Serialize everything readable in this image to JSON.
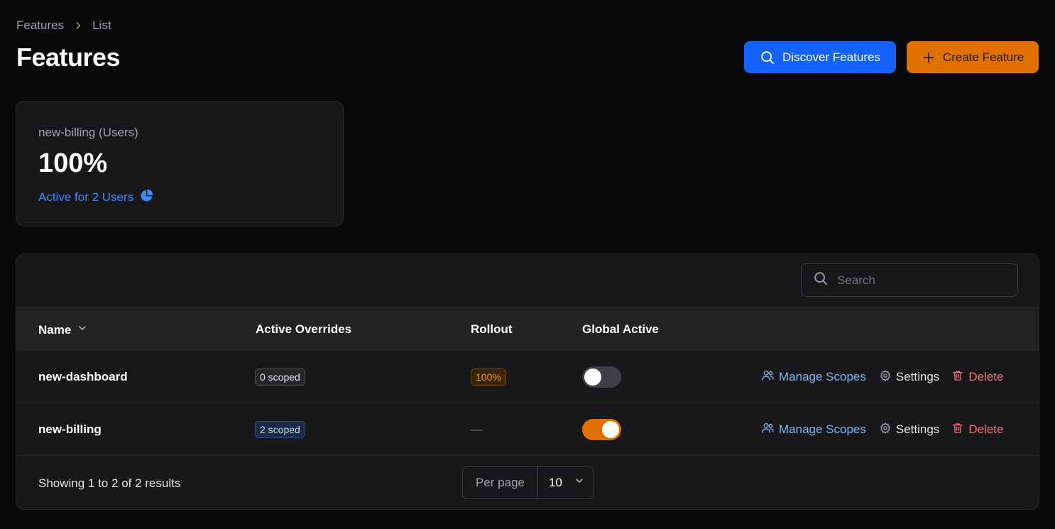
{
  "breadcrumb": {
    "items": [
      "Features",
      "List"
    ]
  },
  "header": {
    "title": "Features",
    "discover_label": "Discover Features",
    "create_label": "Create Feature"
  },
  "stat": {
    "label": "new-billing (Users)",
    "value": "100%",
    "description": "Active for 2 Users"
  },
  "search": {
    "placeholder": "Search",
    "value": ""
  },
  "table": {
    "columns": [
      "Name",
      "Active Overrides",
      "Rollout",
      "Global Active"
    ],
    "rows": [
      {
        "name": "new-dashboard",
        "overrides": "0 scoped",
        "rollout": "100%",
        "global_active": false,
        "manage_label": "Manage Scopes",
        "settings_label": "Settings",
        "delete_label": "Delete"
      },
      {
        "name": "new-billing",
        "overrides": "2 scoped",
        "rollout": "—",
        "global_active": true,
        "manage_label": "Manage Scopes",
        "settings_label": "Settings",
        "delete_label": "Delete"
      }
    ]
  },
  "footer": {
    "results": "Showing 1 to 2 of 2 results",
    "per_page_label": "Per page",
    "per_page_value": "10"
  },
  "colors": {
    "background": "#09090b",
    "primary_blue": "#1463ff",
    "accent_orange": "#e07000",
    "link_blue": "#7ab6f5",
    "danger": "#f87171"
  },
  "icons": [
    "chevron-right-icon",
    "search-icon",
    "plus-icon",
    "pie-chart-icon",
    "chevron-down-icon",
    "users-icon",
    "gear-icon",
    "trash-icon"
  ]
}
